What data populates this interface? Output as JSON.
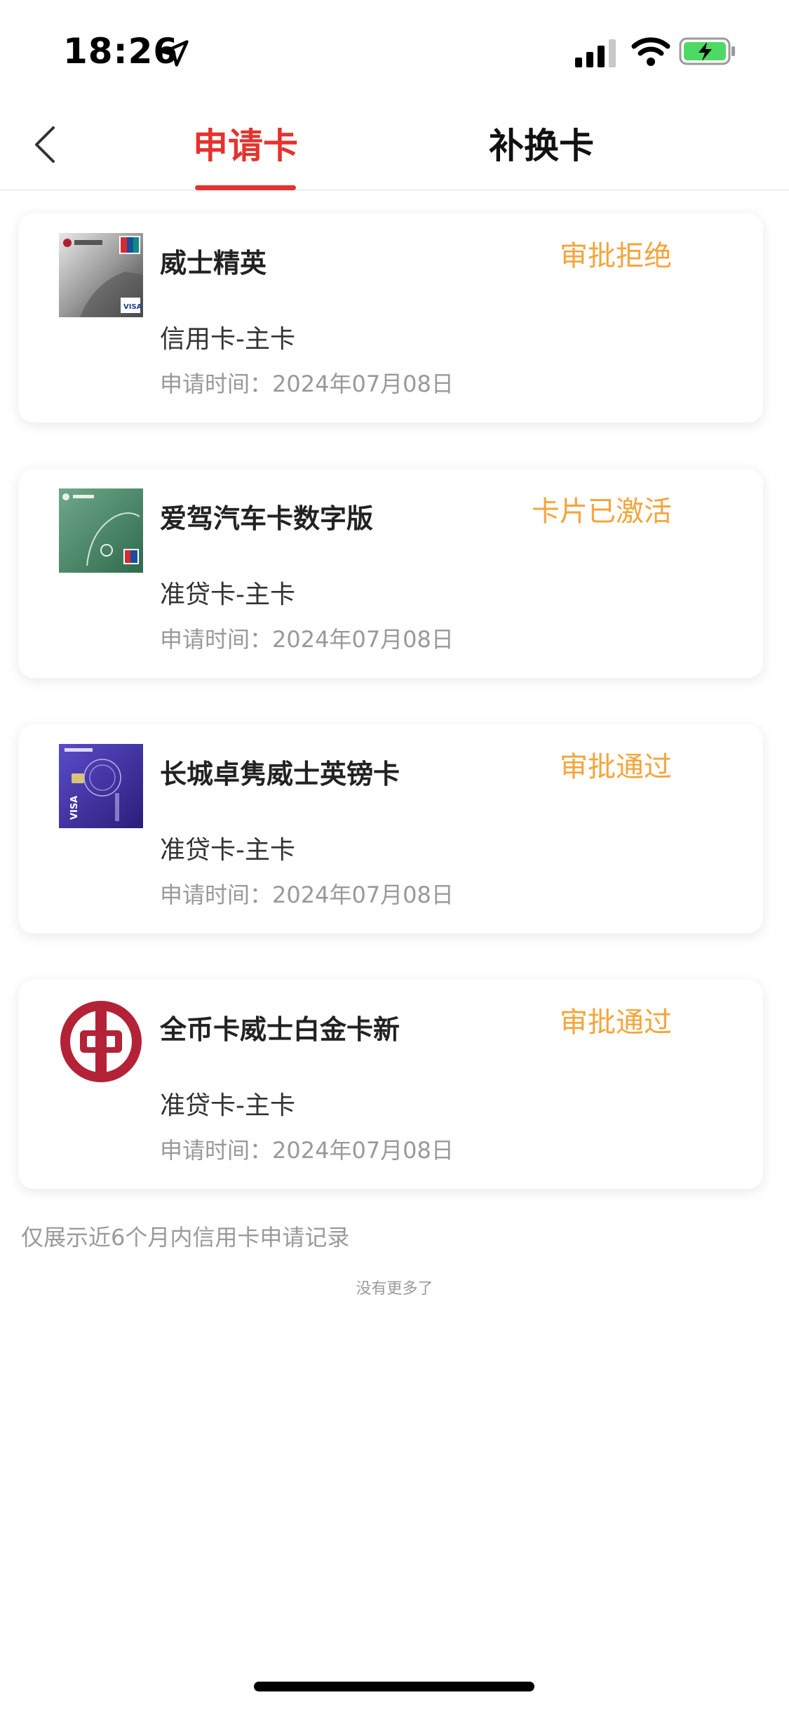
{
  "status_bar": {
    "time": "18:26"
  },
  "nav": {
    "tabs": [
      {
        "label": "申请卡",
        "active": true
      },
      {
        "label": "补换卡",
        "active": false
      }
    ]
  },
  "cards": [
    {
      "name": "威士精英",
      "status": "审批拒绝",
      "type": "信用卡-主卡",
      "time_label": "申请时间：",
      "time": "2024年07月08日",
      "image": "visa-platinum-card-icon"
    },
    {
      "name": "爱驾汽车卡数字版",
      "status": "卡片已激活",
      "type": "准贷卡-主卡",
      "time_label": "申请时间：",
      "time": "2024年07月08日",
      "image": "car-card-icon"
    },
    {
      "name": "长城卓隽威士英镑卡",
      "status": "审批通过",
      "type": "准贷卡-主卡",
      "time_label": "申请时间：",
      "time": "2024年07月08日",
      "image": "gbp-card-icon"
    },
    {
      "name": "全币卡威士白金卡新",
      "status": "审批通过",
      "type": "准贷卡-主卡",
      "time_label": "申请时间：",
      "time": "2024年07月08日",
      "image": "bank-logo-icon"
    }
  ],
  "footnote": "仅展示近6个月内信用卡申请记录",
  "no_more": "没有更多了",
  "colors": {
    "accent": "#e5322d",
    "status": "#f4a53c"
  }
}
